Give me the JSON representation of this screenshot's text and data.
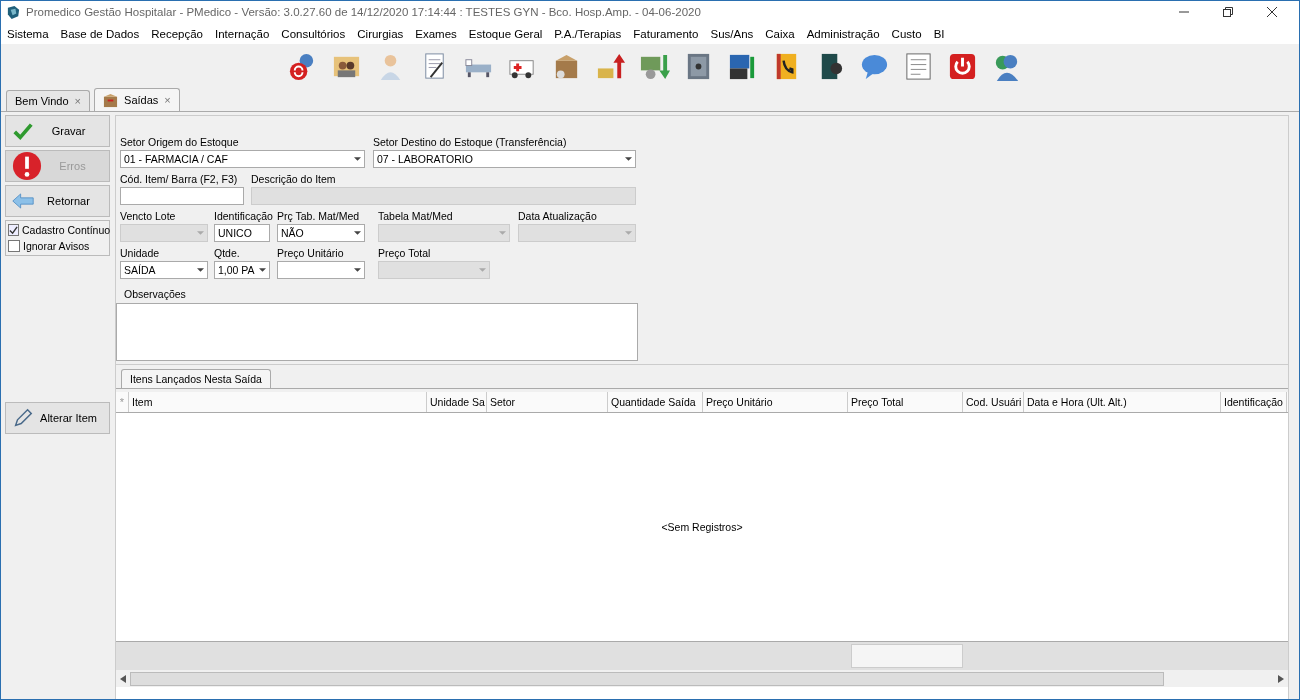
{
  "window": {
    "title": "Promedico Gestão Hospitalar - PMedico - Versão: 3.0.27.60 de 14/12/2020 17:14:44 : TESTES GYN - Bco. Hosp.Amp. - 04-06-2020"
  },
  "menu": [
    "Sistema",
    "Base de Dados",
    "Recepção",
    "Internação",
    "Consultórios",
    "Cirurgias",
    "Exames",
    "Estoque Geral",
    "P.A./Terapias",
    "Faturamento",
    "Sus/Ans",
    "Caixa",
    "Administração",
    "Custo",
    "BI"
  ],
  "tabs": [
    {
      "label": "Bem Vindo",
      "selected": false,
      "close": "×"
    },
    {
      "label": "Saídas",
      "selected": true,
      "close": "×"
    }
  ],
  "actions": [
    {
      "label": "Gravar",
      "kind": "save",
      "disabled": false
    },
    {
      "label": "Erros",
      "kind": "errors",
      "disabled": true
    },
    {
      "label": "Retornar",
      "kind": "back",
      "disabled": false
    }
  ],
  "options": [
    {
      "label": "Cadastro Contínuo",
      "checked": true
    },
    {
      "label": "Ignorar Avisos",
      "checked": false
    }
  ],
  "form": {
    "fields": [
      {
        "label": "Setor Origem do Estoque",
        "kind": "select",
        "value": "01 - FARMACIA / CAF",
        "disabled": false
      },
      {
        "label": "Setor Destino do Estoque (Transferência)",
        "kind": "select",
        "value": "07 - LABORATORIO",
        "disabled": false
      },
      {
        "label": "Cód. Item/ Barra (F2, F3)",
        "kind": "text",
        "disabled": false
      },
      {
        "label": "Descrição do Item",
        "kind": "text",
        "disabled": true
      },
      {
        "label": "Vencto Lote",
        "kind": "select",
        "disabled": true
      },
      {
        "label": "Identificação",
        "kind": "text",
        "value": "UNICO",
        "disabled": false
      },
      {
        "label": "Prç Tab. Mat/Med",
        "kind": "select",
        "value": "NÃO",
        "disabled": false
      },
      {
        "label": "Tabela Mat/Med",
        "kind": "select",
        "disabled": true
      },
      {
        "label": "Data Atualização",
        "kind": "select",
        "disabled": true
      },
      {
        "label": "Unidade",
        "kind": "select",
        "value": "SAÍDA",
        "disabled": false
      },
      {
        "label": "Qtde.",
        "kind": "select",
        "value": "1,00 PA",
        "disabled": false
      },
      {
        "label": "Preço Unitário",
        "kind": "select",
        "disabled": false
      },
      {
        "label": "Preço Total",
        "kind": "select",
        "disabled": true
      }
    ],
    "notes_label": "Observações"
  },
  "edit_button": "Alterar Item",
  "grid": {
    "tab": "Itens Lançados Nesta Saída",
    "marker": "*",
    "columns": [
      "Item",
      "Unidade Sa",
      "Setor",
      "Quantidade Saída",
      "Preço Unitário",
      "Preço Total",
      "Cod. Usuári",
      "Data e Hora (Ult. Alt.)",
      "Identificação"
    ],
    "empty_text": "<Sem Registros>"
  }
}
